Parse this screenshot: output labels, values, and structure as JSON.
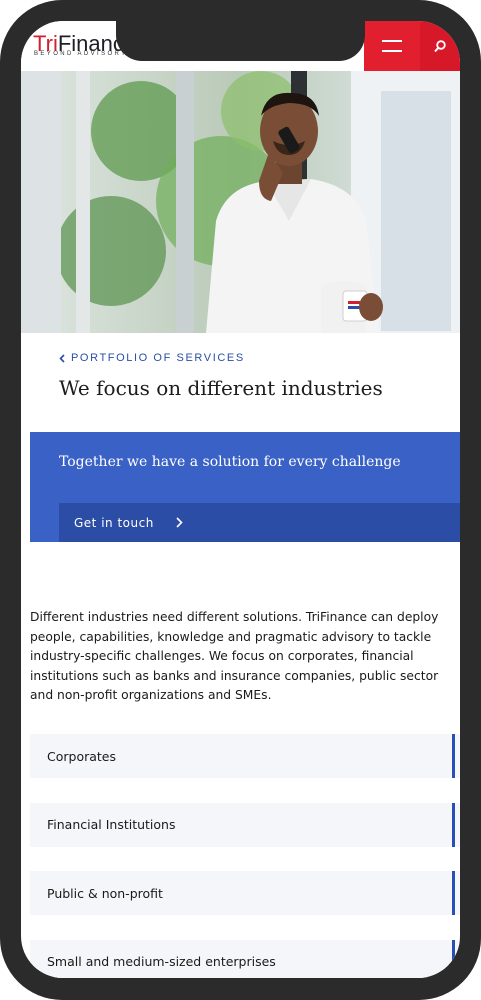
{
  "header": {
    "logo_prefix": "Tri",
    "logo_suffix": "Finance",
    "tagline": "BEYOND ADVISORY",
    "menu_icon": "hamburger-menu-icon",
    "search_icon": "search-icon",
    "brand_color": "#e11f2f"
  },
  "hero": {
    "image": "man-on-phone-holding-mug"
  },
  "breadcrumb": {
    "label": "PORTFOLIO OF SERVICES",
    "icon": "chevron-left-icon"
  },
  "page_title": "We focus on different industries",
  "cta": {
    "text": "Together we have a solution for every challenge",
    "button_label": "Get in touch",
    "button_icon": "chevron-right-icon",
    "color": "#3a62c6"
  },
  "intro": "Different industries need different solutions. TriFinance can deploy people, capabilities, knowledge and pragmatic advisory to tackle industry-specific challenges. We focus on corporates, financial institutions such as banks and insurance companies, public sector and non-profit organizations and SMEs.",
  "industries": [
    {
      "label": "Corporates"
    },
    {
      "label": "Financial Institutions"
    },
    {
      "label": "Public & non-profit"
    },
    {
      "label": "Small and medium-sized enterprises"
    }
  ]
}
